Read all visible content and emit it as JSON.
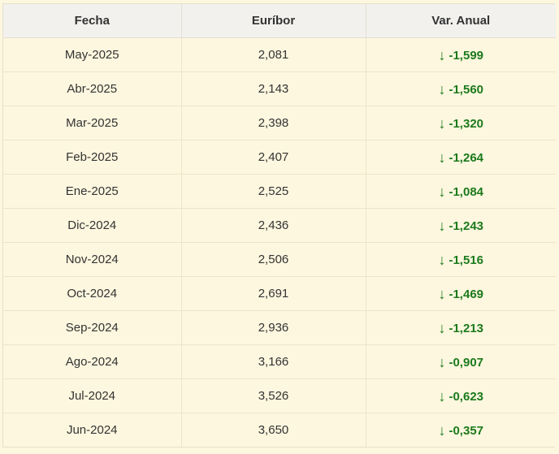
{
  "table": {
    "headers": [
      "Fecha",
      "Euríbor",
      "Var. Anual"
    ],
    "trend_color": "#1c7a1c",
    "rows": [
      {
        "fecha": "May-2025",
        "euribor": "2,081",
        "arrow": "↓",
        "var": "-1,599"
      },
      {
        "fecha": "Abr-2025",
        "euribor": "2,143",
        "arrow": "↓",
        "var": "-1,560"
      },
      {
        "fecha": "Mar-2025",
        "euribor": "2,398",
        "arrow": "↓",
        "var": "-1,320"
      },
      {
        "fecha": "Feb-2025",
        "euribor": "2,407",
        "arrow": "↓",
        "var": "-1,264"
      },
      {
        "fecha": "Ene-2025",
        "euribor": "2,525",
        "arrow": "↓",
        "var": "-1,084"
      },
      {
        "fecha": "Dic-2024",
        "euribor": "2,436",
        "arrow": "↓",
        "var": "-1,243"
      },
      {
        "fecha": "Nov-2024",
        "euribor": "2,506",
        "arrow": "↓",
        "var": "-1,516"
      },
      {
        "fecha": "Oct-2024",
        "euribor": "2,691",
        "arrow": "↓",
        "var": "-1,469"
      },
      {
        "fecha": "Sep-2024",
        "euribor": "2,936",
        "arrow": "↓",
        "var": "-1,213"
      },
      {
        "fecha": "Ago-2024",
        "euribor": "3,166",
        "arrow": "↓",
        "var": "-0,907"
      },
      {
        "fecha": "Jul-2024",
        "euribor": "3,526",
        "arrow": "↓",
        "var": "-0,623"
      },
      {
        "fecha": "Jun-2024",
        "euribor": "3,650",
        "arrow": "↓",
        "var": "-0,357"
      }
    ]
  }
}
